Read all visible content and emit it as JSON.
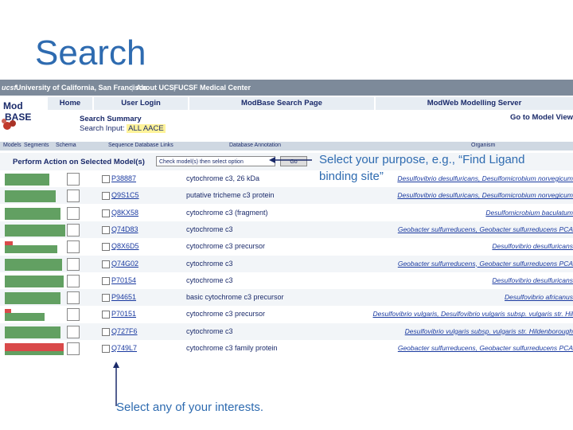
{
  "slide": {
    "title": "Search",
    "callout_purpose": "Select your purpose, e.g., “Find Ligand binding site”",
    "callout_interests": "Select any of your interests."
  },
  "browser": {
    "ucsf_bar": {
      "logo": "ucsf",
      "university": "University of California, San Francisco",
      "about": "About UCSF",
      "medical": "UCSF Medical Center"
    },
    "logo_text": [
      "Mod",
      "BASE"
    ],
    "nav": {
      "home": "Home",
      "login": "User Login",
      "search": "ModBase Search Page",
      "modweb": "ModWeb Modelling Server"
    },
    "summary": {
      "title": "Search Summary",
      "query_label": "Search Input:",
      "query_value": "ALL AACE"
    },
    "goto": "Go to Model View",
    "columns": {
      "models": "Models",
      "segments": "Segments",
      "schema": "Schema",
      "sequence": "Sequence Database Links",
      "annotation": "Database Annotation",
      "organism": "Organism"
    },
    "action": {
      "label": "Perform Action on Selected Model(s)",
      "select_value": "Check model(s) then select option",
      "go": "Go"
    },
    "rows": [
      {
        "acc": "P38887",
        "desc": "cytochrome c3, 26 kDa",
        "org": "Desulfovibrio desulfuricans, Desulfomicrobium norvegicum",
        "bars": [
          56,
          56,
          56
        ],
        "red": [
          false,
          false,
          false
        ]
      },
      {
        "acc": "Q9S1C5",
        "desc": "putative tricheme c3 protein",
        "org": "Desulfovibrio desulfuricans, Desulfomicrobium norvegicum",
        "bars": [
          64,
          64,
          64
        ],
        "red": [
          false,
          false,
          false
        ]
      },
      {
        "acc": "Q8KX58",
        "desc": "cytochrome c3 (fragment)",
        "org": "Desulfomicrobium baculatum",
        "bars": [
          70,
          70,
          70
        ],
        "red": [
          false,
          false,
          false
        ]
      },
      {
        "acc": "Q74D83",
        "desc": "cytochrome c3",
        "org": "Geobacter sulfurreducens, Geobacter sulfurreducens PCA",
        "bars": [
          76,
          76,
          76
        ],
        "red": [
          false,
          false,
          false
        ]
      },
      {
        "acc": "Q8X6D5",
        "desc": "cytochrome c3 precursor",
        "org": "Desulfovibrio desulfuricans",
        "bars": [
          10,
          66,
          66
        ],
        "red": [
          true,
          false,
          false
        ]
      },
      {
        "acc": "Q74G02",
        "desc": "cytochrome c3",
        "org": "Geobacter sulfurreducens, Geobacter sulfurreducens PCA",
        "bars": [
          72,
          72,
          72
        ],
        "red": [
          false,
          false,
          false
        ]
      },
      {
        "acc": "P70154",
        "desc": "cytochrome c3",
        "org": "Desulfovibrio desulfuricans",
        "bars": [
          74,
          74,
          74
        ],
        "red": [
          false,
          false,
          false
        ]
      },
      {
        "acc": "P94651",
        "desc": "basic cytochrome c3 precursor",
        "org": "Desulfovibrio africanus",
        "bars": [
          70,
          70,
          70
        ],
        "red": [
          false,
          false,
          false
        ]
      },
      {
        "acc": "P70151",
        "desc": "cytochrome c3 precursor",
        "org": "Desulfovibrio vulgaris, Desulfovibrio vulgaris subsp. vulgaris str. Hil",
        "bars": [
          8,
          50,
          50
        ],
        "red": [
          true,
          false,
          false
        ]
      },
      {
        "acc": "Q727F6",
        "desc": "cytochrome c3",
        "org": "Desulfovibrio vulgaris subsp. vulgaris str. Hildenborough",
        "bars": [
          70,
          70,
          70
        ],
        "red": [
          false,
          false,
          false
        ]
      },
      {
        "acc": "Q749L7",
        "desc": "cytochrome c3 family protein",
        "org": "Geobacter sulfurreducens, Geobacter sulfurreducens PCA",
        "bars": [
          74,
          74,
          74
        ],
        "red": [
          true,
          true,
          false
        ]
      }
    ]
  },
  "colors": {
    "slide_text": "#2e6bb0",
    "link": "#1a3aa0",
    "header_bg": "#7d8a9a",
    "bar_green": "#62a062",
    "bar_red": "#d94a4a"
  }
}
